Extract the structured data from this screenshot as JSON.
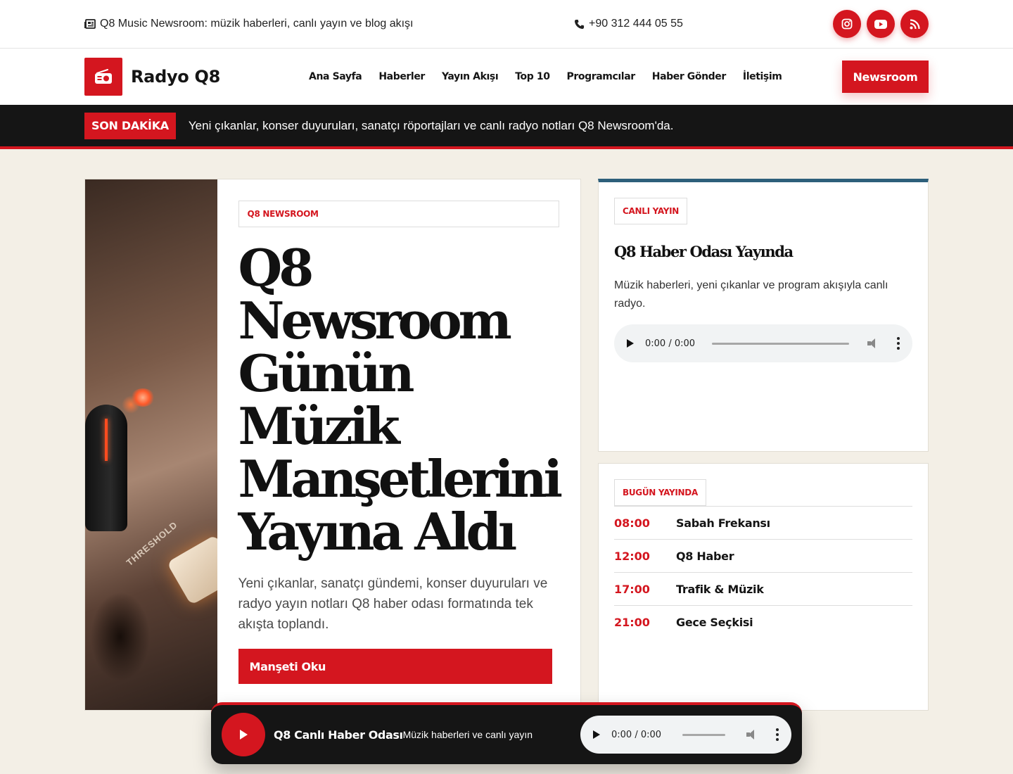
{
  "topbar": {
    "tagline": "Q8 Music Newsroom: müzik haberleri, canlı yayın ve blog akışı",
    "phone": "+90 312 444 05 55",
    "socials": [
      "instagram-icon",
      "youtube-icon",
      "rss-icon"
    ],
    "accent": "#d4161f"
  },
  "header": {
    "logo_text": "Radyo Q8",
    "nav": [
      "Ana Sayfa",
      "Haberler",
      "Yayın Akışı",
      "Top 10",
      "Programcılar",
      "Haber Gönder",
      "İletişim"
    ],
    "cta": "Newsroom"
  },
  "ticker": {
    "label": "SON DAKİKA",
    "text": "Yeni çıkanlar, konser duyuruları, sanatçı röportajları ve canlı radyo notları Q8 Newsroom'da."
  },
  "hero": {
    "badge": "Q8 NEWSROOM",
    "title_lines": [
      "Q8",
      "Newsroom",
      "Günün",
      "Müzik",
      "Manşetlerini",
      "Yayına Aldı"
    ],
    "image_label": "THRESHOLD",
    "description": "Yeni çıkanlar, sanatçı gündemi, konser duyuruları ve radyo yayın notları Q8 haber odası formatında tek akışta toplandı.",
    "button": "Manşeti Oku"
  },
  "live": {
    "badge": "CANLI YAYIN",
    "title": "Q8 Haber Odası Yayında",
    "description": "Müzik haberleri, yeni çıkanlar ve program akışıyla canlı radyo.",
    "audio_time": "0:00 / 0:00"
  },
  "schedule": {
    "badge": "BUGÜN YAYINDA",
    "items": [
      {
        "time": "08:00",
        "name": "Sabah Frekansı"
      },
      {
        "time": "12:00",
        "name": "Q8 Haber"
      },
      {
        "time": "17:00",
        "name": "Trafik & Müzik"
      },
      {
        "time": "21:00",
        "name": "Gece Seçkisi"
      }
    ]
  },
  "player": {
    "title": "Q8 Canlı Haber Odası",
    "subtitle": "Müzik haberleri ve canlı yayın",
    "audio_time": "0:00 / 0:00"
  }
}
